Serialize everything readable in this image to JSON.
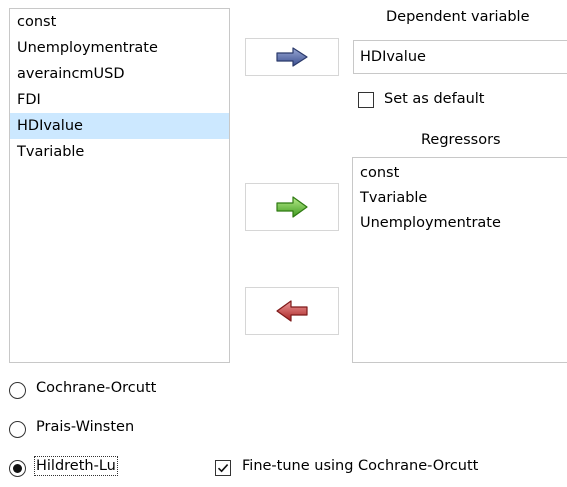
{
  "left_list": {
    "items": [
      {
        "label": "const"
      },
      {
        "label": "Unemploymentrate"
      },
      {
        "label": "averaincmUSD"
      },
      {
        "label": "FDI"
      },
      {
        "label": "HDIvalue"
      },
      {
        "label": "Tvariable"
      }
    ],
    "selected": "HDIvalue"
  },
  "dependent": {
    "heading": "Dependent variable",
    "value": "HDIvalue",
    "set_default_label": "Set as default",
    "set_default_checked": false
  },
  "regressors": {
    "heading": "Regressors",
    "items": [
      {
        "label": "const"
      },
      {
        "label": "Tvariable"
      },
      {
        "label": "Unemploymentrate"
      }
    ]
  },
  "buttons": {
    "dependent_arrow_icon": "arrow-right-blue",
    "add_regressor_icon": "arrow-right-green",
    "remove_regressor_icon": "arrow-left-red"
  },
  "method_options": {
    "selected": "Hildreth-Lu",
    "options": [
      {
        "label": "Cochrane-Orcutt"
      },
      {
        "label": "Prais-Winsten"
      },
      {
        "label": "Hildreth-Lu"
      }
    ],
    "fine_tune_label": "Fine-tune using Cochrane-Orcutt",
    "fine_tune_checked": true
  },
  "colors": {
    "selection": "#cce8ff",
    "arrow_blue": "#4a5e9e",
    "arrow_green": "#5ab832",
    "arrow_red": "#c23a3a"
  }
}
